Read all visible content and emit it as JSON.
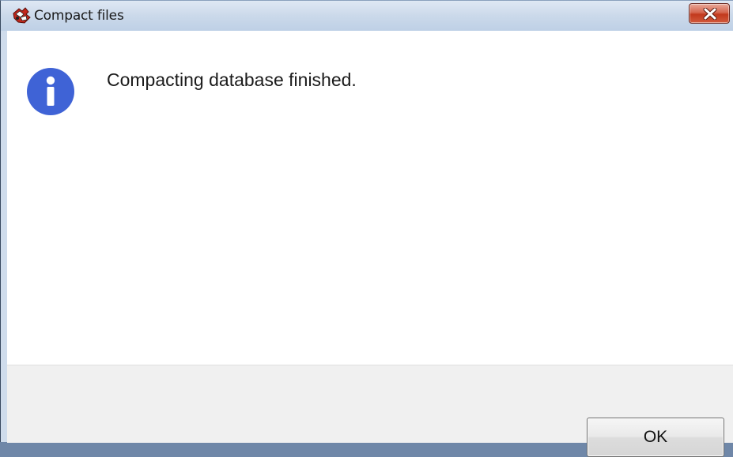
{
  "window": {
    "title": "Compact files",
    "app_icon": "app-logo-icon",
    "close_icon": "close-icon"
  },
  "dialog": {
    "icon": "info-icon",
    "message": "Compacting database finished."
  },
  "buttons": {
    "ok_label": "OK"
  },
  "colors": {
    "info_icon": "#3f63d6",
    "close_button": "#c2391d",
    "footer_bg": "#f0f0f0"
  }
}
